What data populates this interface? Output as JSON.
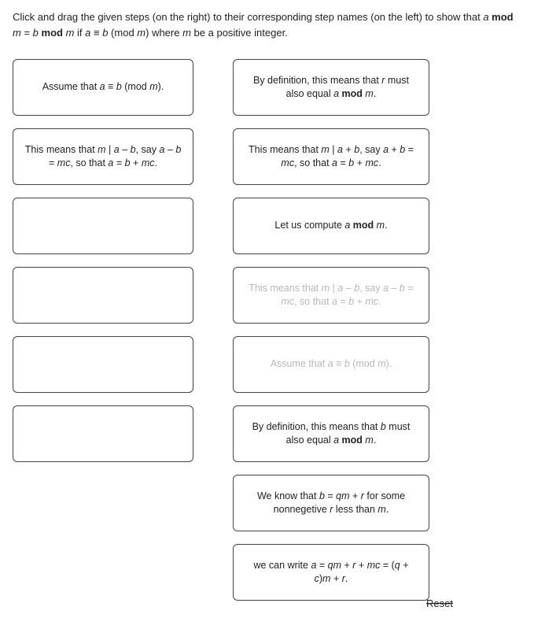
{
  "instructions": {
    "pre": "Click and drag the given steps (on the right) to their corresponding step names (on the left) to show that ",
    "eq1_a": "a",
    "eq1_mod": " mod ",
    "eq1_m": "m",
    "eq1_eq": " = ",
    "eq1_b": "b",
    "eq1_mod2": " mod ",
    "eq1_m2": "m",
    "if": " if ",
    "cond_a": "a",
    "cond_eq": " ≡ ",
    "cond_b": "b",
    "cond_open": " (mod ",
    "cond_m": "m",
    "cond_close": ") where ",
    "cond_m3": "m",
    "tail": " be a positive integer."
  },
  "left": [
    {
      "pre": "Assume that ",
      "a": "a",
      "eq": " ≡ ",
      "b": "b",
      "open": " (mod ",
      "m": "m",
      "close": ")."
    },
    {
      "pre": "This means that ",
      "m1": "m",
      "div": " | ",
      "a1": "a",
      "minus": " – ",
      "b1": "b",
      "say": ", say ",
      "a2": "a",
      "minus2": " – ",
      "b2": "b",
      "eqmc": " = ",
      "mc": "mc",
      "so": ", so that ",
      "a3": "a",
      "eq2": " = ",
      "b3": "b",
      "plus": " + ",
      "mc2": "mc",
      "dot": "."
    },
    {
      "empty": ""
    },
    {
      "empty": ""
    },
    {
      "empty": ""
    },
    {
      "empty": ""
    }
  ],
  "right": [
    {
      "pre": "By definition, this means that ",
      "r": "r",
      "mid": " must also equal ",
      "a": "a",
      "mod": " mod ",
      "m": "m",
      "dot": "."
    },
    {
      "pre": "This means that ",
      "m1": "m",
      "div": " | ",
      "a1": "a",
      "plus": " + ",
      "b1": "b",
      "say": ", say ",
      "a2": "a",
      "plus2": " + ",
      "b2": "b",
      "eqmc": " = ",
      "mc": "mc",
      "so": ", so that ",
      "a3": "a",
      "eq2": " = ",
      "b3": "b",
      "plus3": " + ",
      "mc2": "mc",
      "dot": "."
    },
    {
      "pre": "Let us compute ",
      "a": "a",
      "mod": " mod ",
      "m": "m",
      "dot": "."
    },
    {
      "ghost": true,
      "pre": "This means that ",
      "m1": "m",
      "div": " | ",
      "a1": "a",
      "minus": " – ",
      "b1": "b",
      "say": ", say ",
      "a2": "a",
      "minus2": " – ",
      "b2": "b",
      "eqmc": " = ",
      "mc": "mc",
      "so": ", so that ",
      "a3": "a",
      "eq2": " = ",
      "b3": "b",
      "plus": " + ",
      "mc2": "mc",
      "dot": "."
    },
    {
      "ghost": true,
      "pre": "Assume that ",
      "a": "a",
      "eq": " ≡ ",
      "b": "b",
      "open": " (mod ",
      "m": "m",
      "close": ")."
    },
    {
      "pre": "By definition, this means that ",
      "b": "b",
      "mid": " must also equal ",
      "a": "a",
      "mod": " mod ",
      "m": "m",
      "dot": "."
    },
    {
      "pre": "We know that ",
      "b": "b",
      "eq": " = ",
      "qm": "qm",
      "plus": " + ",
      "r": "r",
      "for": " for some nonnegetive ",
      "r2": "r",
      "less": " less than ",
      "m": "m",
      "dot": "."
    },
    {
      "pre": "we can write ",
      "a": "a",
      "eq1": " = ",
      "qm": "qm",
      "p1": " + ",
      "r": "r",
      "p2": " + ",
      "mc": "mc",
      "eq2": " = (",
      "q": "q",
      "p3": " + ",
      "c": "c",
      "close": ")",
      "m": "m",
      "p4": " + ",
      "r2": "r",
      "dot": "."
    }
  ],
  "reset": "Reset"
}
